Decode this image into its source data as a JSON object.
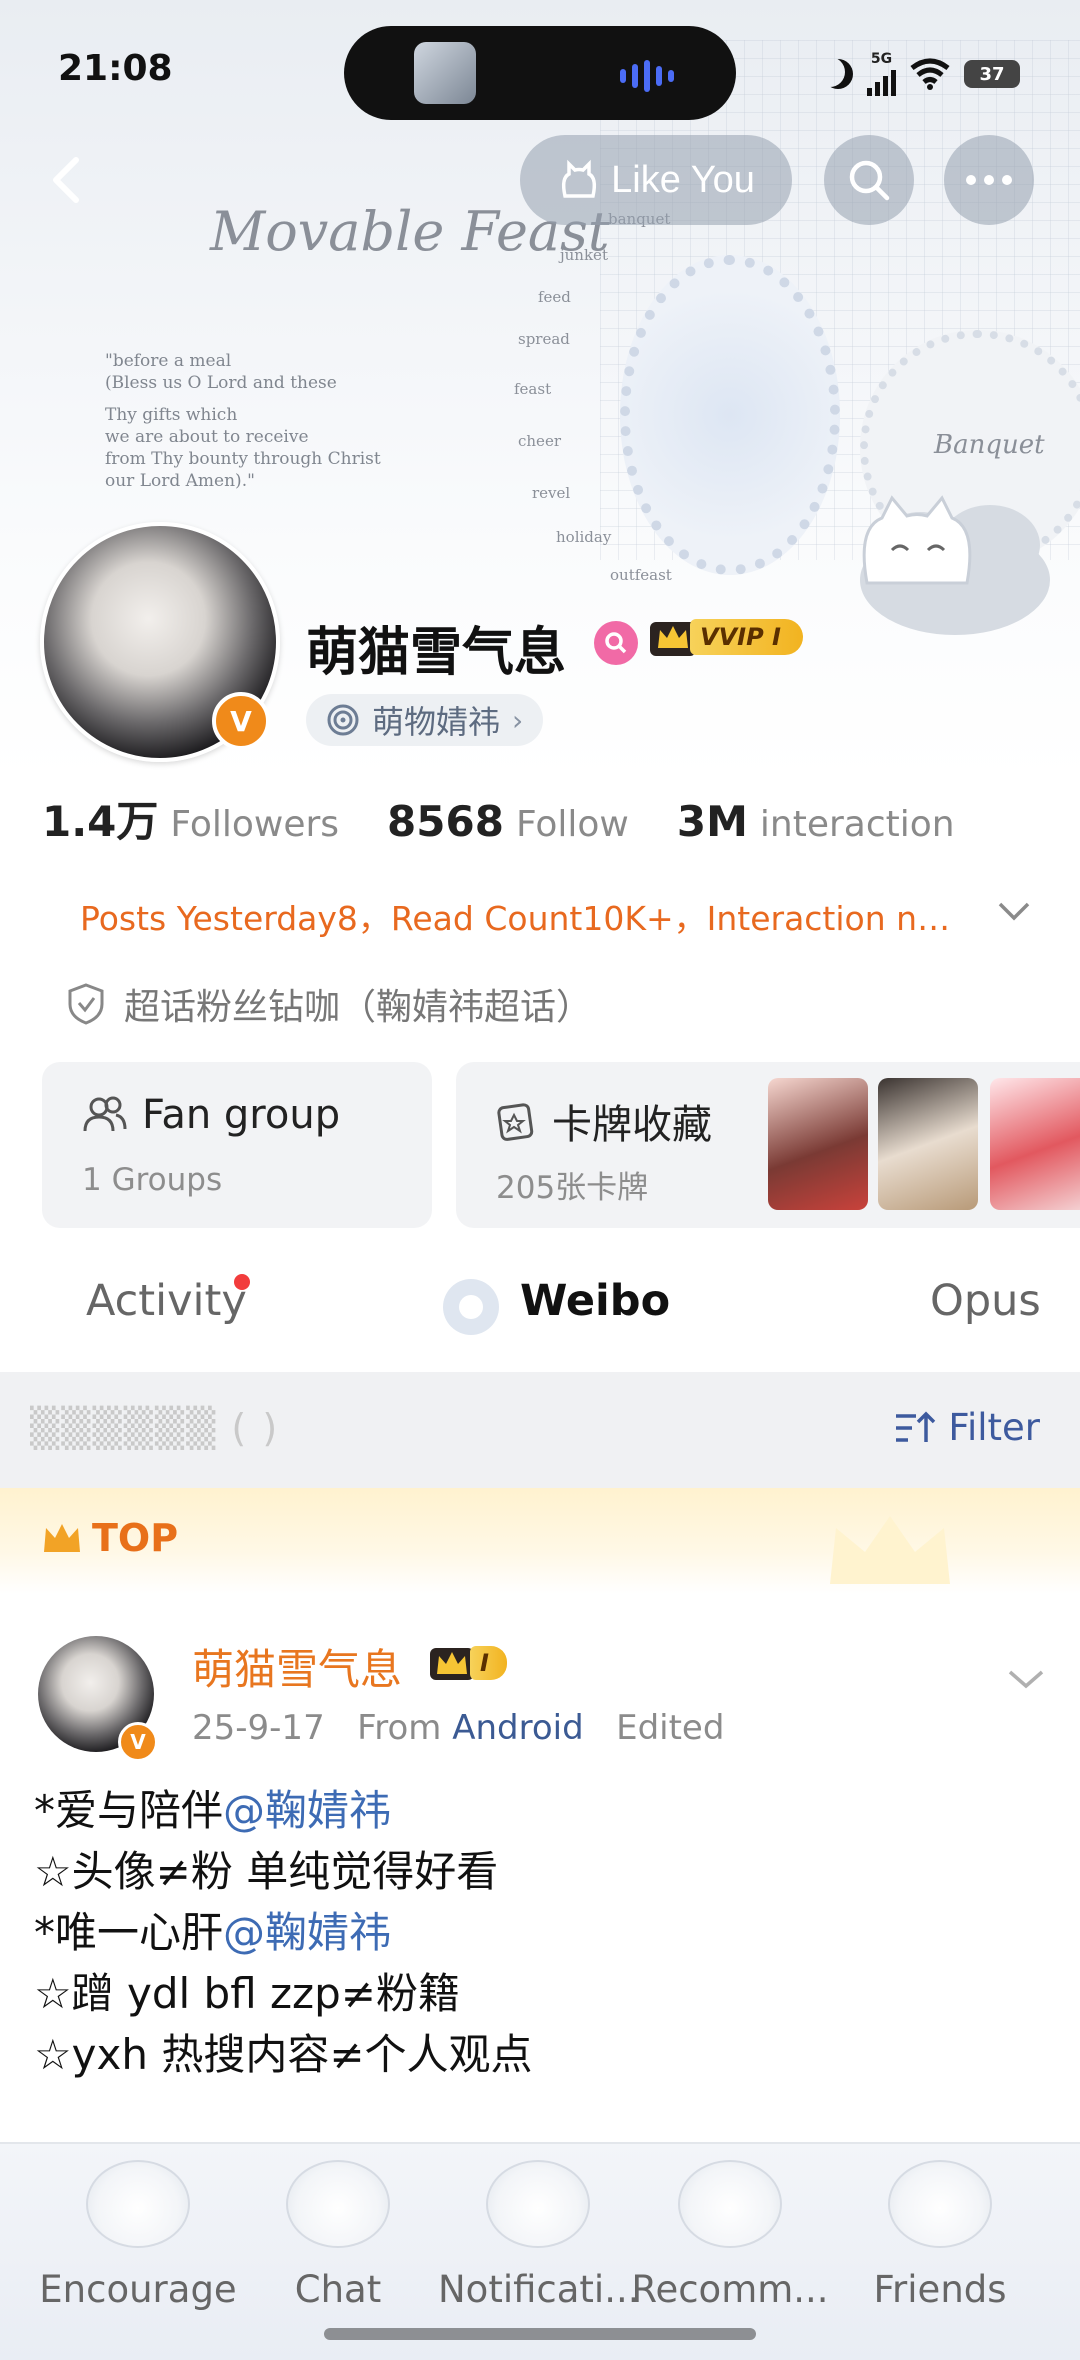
{
  "status_bar": {
    "time": "21:08",
    "network": "5G",
    "battery": "37"
  },
  "top_nav": {
    "like_you_label": "Like You"
  },
  "background_text": {
    "title": "Movable Feast",
    "verse": [
      "\"before a meal",
      "(Bless us O Lord and these",
      "Thy gifts which",
      "we are about to receive",
      "from Thy bounty through Christ",
      "our Lord Amen).\""
    ],
    "words": [
      "banquet",
      "junket",
      "feed",
      "spread",
      "feast",
      "cheer",
      "revel",
      "holiday",
      "outfeast"
    ],
    "banquet_script": "Banquet"
  },
  "profile": {
    "username": "萌猫雪气息",
    "vip_label": "VVIP I",
    "topic": "萌物婧祎",
    "verified_letter": "V",
    "stats": [
      {
        "value": "1.4万",
        "label": "Followers"
      },
      {
        "value": "8568",
        "label": "Follow"
      },
      {
        "value": "3M",
        "label": "interaction"
      }
    ],
    "post_info": "Posts Yesterday8，Read Count10K+，Interaction nu...",
    "super_topic": "超话粉丝钻咖（鞠婧祎超话）"
  },
  "cards": {
    "fan_group": {
      "title": "Fan group",
      "subtitle": "1 Groups"
    },
    "card_collection": {
      "title": "卡牌收藏",
      "subtitle": "205张卡牌"
    }
  },
  "tabs": [
    {
      "label": "Activity",
      "active": false
    },
    {
      "label": "Weibo",
      "active": true
    },
    {
      "label": "Opus",
      "active": false
    }
  ],
  "filter": {
    "label": "Filter",
    "blurred_text": "(  )"
  },
  "top_label": "TOP",
  "post": {
    "author": "萌猫雪气息",
    "crown_level": "I",
    "date": "25-9-17",
    "from_label": "From",
    "source": "Android",
    "edited": "Edited",
    "lines": [
      {
        "text": "*爱与陪伴",
        "mention": "@鞠婧祎"
      },
      {
        "text": "☆头像≠粉 单纯觉得好看",
        "mention": ""
      },
      {
        "text": "*唯一心肝",
        "mention": "@鞠婧祎"
      },
      {
        "text": "☆蹭 ydl bfl zzp≠粉籍",
        "mention": ""
      },
      {
        "text": "☆yxh 热搜内容≠个人观点",
        "mention": ""
      }
    ]
  },
  "bottom_nav": [
    {
      "label": "Encourage"
    },
    {
      "label": "Chat"
    },
    {
      "label": "Notificati..."
    },
    {
      "label": "Recomm..."
    },
    {
      "label": "Friends"
    }
  ],
  "colors": {
    "accent_orange": "#e8701a",
    "link_blue": "#3d6bb4",
    "vip_gold": "#f2b320"
  }
}
